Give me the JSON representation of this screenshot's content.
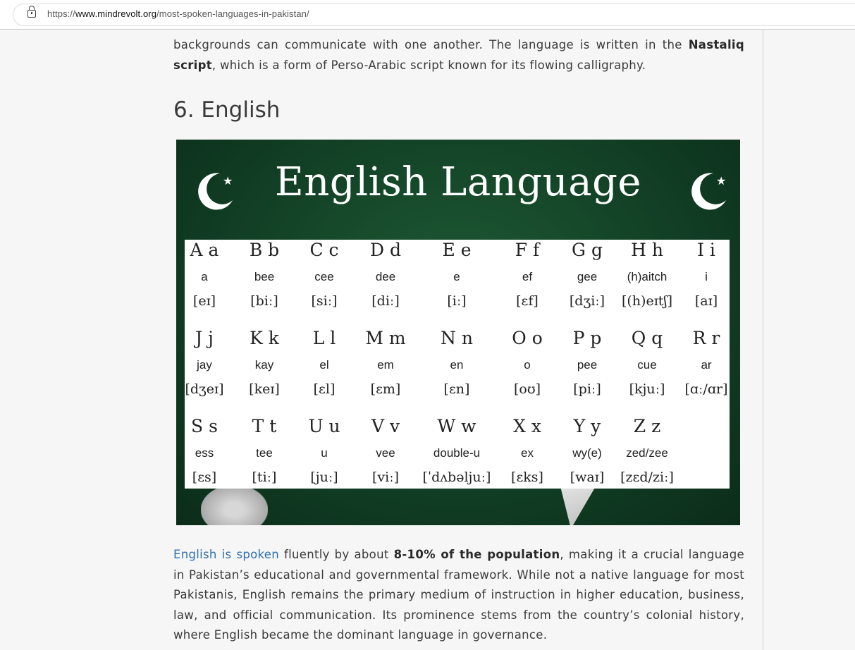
{
  "browser": {
    "url_prefix": "https://",
    "url_domain": "www.mindrevolt.org",
    "url_path": "/most-spoken-languages-in-pakistan/"
  },
  "intro": {
    "p1": "backgrounds can communicate with one another. The language is written in the ",
    "b1": "Nastaliq",
    "b2": "script",
    "p2": ", which is a form of Perso-Arabic script known for its flowing calligraphy."
  },
  "section": {
    "heading": "6. English"
  },
  "image": {
    "title": "English Language",
    "colors": {
      "board": "#124026",
      "card": "#ffffff",
      "text": "#ffffff"
    },
    "icons": [
      "crescent-star-icon",
      "crescent-star-icon"
    ],
    "alphabet": [
      [
        {
          "l": "A a",
          "n": "a",
          "p": "[eɪ]"
        },
        {
          "l": "B b",
          "n": "bee",
          "p": "[biː]"
        },
        {
          "l": "C c",
          "n": "cee",
          "p": "[siː]"
        },
        {
          "l": "D d",
          "n": "dee",
          "p": "[diː]"
        },
        {
          "l": "E e",
          "n": "e",
          "p": "[iː]"
        },
        {
          "l": "F f",
          "n": "ef",
          "p": "[ɛf]"
        },
        {
          "l": "G g",
          "n": "gee",
          "p": "[dʒiː]"
        },
        {
          "l": "H h",
          "n": "(h)aitch",
          "p": "[(h)eɪtʃ]"
        },
        {
          "l": "I i",
          "n": "i",
          "p": "[aɪ]"
        }
      ],
      [
        {
          "l": "J j",
          "n": "jay",
          "p": "[dʒeɪ]"
        },
        {
          "l": "K k",
          "n": "kay",
          "p": "[keɪ]"
        },
        {
          "l": "L l",
          "n": "el",
          "p": "[ɛl]"
        },
        {
          "l": "M m",
          "n": "em",
          "p": "[ɛm]"
        },
        {
          "l": "N n",
          "n": "en",
          "p": "[ɛn]"
        },
        {
          "l": "O o",
          "n": "o",
          "p": "[oʊ]"
        },
        {
          "l": "P p",
          "n": "pee",
          "p": "[piː]"
        },
        {
          "l": "Q q",
          "n": "cue",
          "p": "[kjuː]"
        },
        {
          "l": "R r",
          "n": "ar",
          "p": "[ɑː/ɑr]"
        }
      ],
      [
        {
          "l": "S s",
          "n": "ess",
          "p": "[ɛs]"
        },
        {
          "l": "T t",
          "n": "tee",
          "p": "[tiː]"
        },
        {
          "l": "U u",
          "n": "u",
          "p": "[juː]"
        },
        {
          "l": "V v",
          "n": "vee",
          "p": "[viː]"
        },
        {
          "l": "W w",
          "n": "double-u",
          "p": "[ˈdʌbəljuː]"
        },
        {
          "l": "X x",
          "n": "ex",
          "p": "[ɛks]"
        },
        {
          "l": "Y y",
          "n": "wy(e)",
          "p": "[waɪ]"
        },
        {
          "l": "Z z",
          "n": "zed/zee",
          "p": "[zɛd/ziː]"
        }
      ]
    ]
  },
  "body": {
    "link": "English is spoken",
    "t1": " fluently by about ",
    "b1": "8-10% of the population",
    "t2": ", making it a crucial language in Pakistan’s educational and governmental framework. While not a native language for most Pakistanis, English remains the primary medium of instruction in higher education, business, law, and official communication. Its prominence stems from the country’s colonial history, where English became the dominant language in governance."
  }
}
